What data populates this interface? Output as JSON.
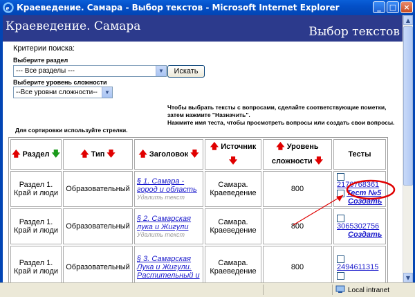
{
  "window": {
    "title": "Краеведение. Самара - Выбор текстов - Microsoft Internet Explorer",
    "buttons": [
      "_",
      "□",
      "×"
    ]
  },
  "banner": {
    "site_title": "Краеведение. Самара",
    "page_title": "Выбор текстов"
  },
  "search": {
    "heading": "Критерии поиска:",
    "section_label": "Выберите раздел",
    "section_value": "--- Все разделы ---",
    "search_button": "Искать",
    "level_label": "Выберите уровень сложности",
    "level_value": "--Все уровни сложности--"
  },
  "info": {
    "instructions_1": "Чтобы выбрать тексты с вопросами, сделайте соответствующие пометки, затем нажмите \"Назначить\".",
    "instructions_2": "Нажмите имя теста, чтобы просмотреть вопросы или создать свои вопросы.",
    "sort_hint": "Для сортировки используйте стрелки."
  },
  "table": {
    "headers": [
      "Раздел",
      "Тип",
      "Заголовок",
      "Источник",
      "Уровень сложности",
      "Тесты"
    ],
    "rows": [
      {
        "section_1": "Раздел 1.",
        "section_2": "Край и люди",
        "type": "Образовательный",
        "title": "§ 1. Самара - город и область",
        "delete": "Удалить текст",
        "source_1": "Самара.",
        "source_2": "Краеведение",
        "level": "800",
        "test_id": "2170768361",
        "test_name": "Тест №5",
        "create": "Создать"
      },
      {
        "section_1": "Раздел 1.",
        "section_2": "Край и люди",
        "type": "Образовательный",
        "title": "§ 2. Самарская лука и Жигули",
        "delete": "Удалить текст",
        "source_1": "Самара.",
        "source_2": "Краеведение",
        "level": "800",
        "test_id": "3065302756",
        "create": "Создать"
      },
      {
        "section_1": "Раздел 1.",
        "section_2": "Край и люди",
        "type": "Образовательный",
        "title": "§ 3. Самарская Лука и Жигули. Растительный и",
        "source_1": "Самара.",
        "source_2": "Краеведение",
        "level": "800",
        "test_id": "2494611315"
      }
    ]
  },
  "statusbar": {
    "zone": "Local intranet"
  },
  "colors": {
    "banner": "#2c3a8c",
    "highlight": "#e00000",
    "link": "#1a1acc"
  }
}
